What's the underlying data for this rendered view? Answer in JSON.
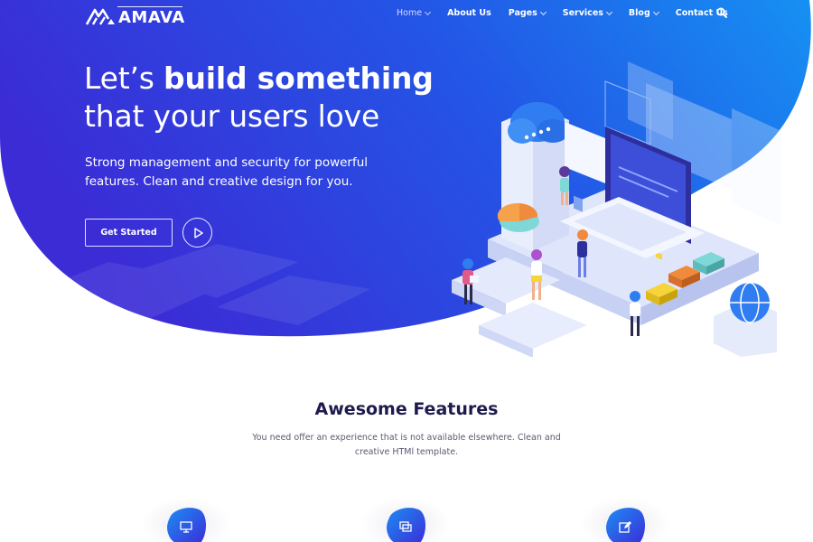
{
  "brand": {
    "name": "AMAVA"
  },
  "nav": {
    "items": [
      {
        "label": "Home",
        "has_dropdown": true,
        "active": true
      },
      {
        "label": "About Us",
        "has_dropdown": false,
        "active": false
      },
      {
        "label": "Pages",
        "has_dropdown": true,
        "active": false
      },
      {
        "label": "Services",
        "has_dropdown": true,
        "active": false
      },
      {
        "label": "Blog",
        "has_dropdown": true,
        "active": false
      },
      {
        "label": "Contact Us",
        "has_dropdown": false,
        "active": false
      }
    ],
    "search_icon": "search-icon"
  },
  "hero": {
    "title_part1": "Let’s ",
    "title_bold": "build something",
    "title_line2": "that your users love",
    "subtitle": "Strong management and security for powerful features. Clean and creative design for you.",
    "cta_label": "Get Started",
    "play_icon": "play-icon"
  },
  "features": {
    "title": "Awesome Features",
    "description": "You need offer an experience that is not available elsewhere. Clean and creative HTMl template.",
    "cards": [
      {
        "icon": "presentation-icon"
      },
      {
        "icon": "windows-icon"
      },
      {
        "icon": "edit-icon"
      }
    ]
  },
  "colors": {
    "hero_gradient_start": "#3a2ad4",
    "hero_gradient_end": "#1a8cf0",
    "title_dark": "#1d1b4c",
    "accent_teal": "#7fd8d8",
    "accent_orange": "#f08a3c",
    "accent_yellow": "#f6d43a"
  }
}
